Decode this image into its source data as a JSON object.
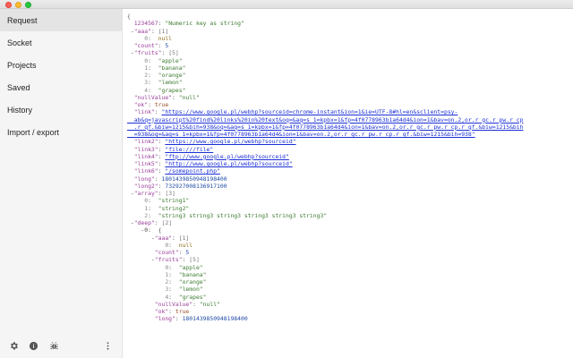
{
  "sidebar": {
    "items": [
      {
        "label": "Request",
        "active": true
      },
      {
        "label": "Socket",
        "active": false
      },
      {
        "label": "Projects",
        "active": false
      },
      {
        "label": "Saved",
        "active": false
      },
      {
        "label": "History",
        "active": false
      },
      {
        "label": "Import / export",
        "active": false
      }
    ],
    "footer_icons": [
      "gear-icon",
      "info-icon",
      "bug-icon",
      "more-vertical-icon"
    ]
  },
  "json_view": {
    "lines": [
      [
        {
          "t": "{",
          "c": "punc"
        }
      ],
      [
        {
          "t": "  1234567",
          "c": "key"
        },
        {
          "t": ": ",
          "c": "punc"
        },
        {
          "t": "\"Numeric key as string\"",
          "c": "str"
        }
      ],
      [
        {
          "t": " -",
          "c": "tog"
        },
        {
          "t": "\"aaa\"",
          "c": "key"
        },
        {
          "t": ": ",
          "c": "punc"
        },
        {
          "t": "[1]",
          "c": "cnt"
        }
      ],
      [
        {
          "t": "     0",
          "c": "idx"
        },
        {
          "t": ":  ",
          "c": "punc"
        },
        {
          "t": "null",
          "c": "nul"
        }
      ],
      [
        {
          "t": "  \"count\"",
          "c": "key"
        },
        {
          "t": ": ",
          "c": "punc"
        },
        {
          "t": "5",
          "c": "num"
        }
      ],
      [
        {
          "t": " -",
          "c": "tog"
        },
        {
          "t": "\"fruits\"",
          "c": "key"
        },
        {
          "t": ": ",
          "c": "punc"
        },
        {
          "t": "[5]",
          "c": "cnt"
        }
      ],
      [
        {
          "t": "     0",
          "c": "idx"
        },
        {
          "t": ":  ",
          "c": "punc"
        },
        {
          "t": "\"apple\"",
          "c": "str"
        }
      ],
      [
        {
          "t": "     1",
          "c": "idx"
        },
        {
          "t": ":  ",
          "c": "punc"
        },
        {
          "t": "\"banana\"",
          "c": "str"
        }
      ],
      [
        {
          "t": "     2",
          "c": "idx"
        },
        {
          "t": ":  ",
          "c": "punc"
        },
        {
          "t": "\"orange\"",
          "c": "str"
        }
      ],
      [
        {
          "t": "     3",
          "c": "idx"
        },
        {
          "t": ":  ",
          "c": "punc"
        },
        {
          "t": "\"lemon\"",
          "c": "str"
        }
      ],
      [
        {
          "t": "     4",
          "c": "idx"
        },
        {
          "t": ":  ",
          "c": "punc"
        },
        {
          "t": "\"grapes\"",
          "c": "str"
        }
      ],
      [
        {
          "t": "  \"nullValue\"",
          "c": "key"
        },
        {
          "t": ": ",
          "c": "punc"
        },
        {
          "t": "\"null\"",
          "c": "str"
        }
      ],
      [
        {
          "t": "  \"ok\"",
          "c": "key"
        },
        {
          "t": ": ",
          "c": "punc"
        },
        {
          "t": "true",
          "c": "bool"
        }
      ],
      [
        {
          "t": "  \"link\"",
          "c": "key"
        },
        {
          "t": ": ",
          "c": "punc"
        },
        {
          "t": "\"https://www.google.pl/webhp?sourceid=chrome-instant&ion=1&ie=UTF-8#hl=en&sclient=psy-",
          "c": "link"
        }
      ],
      [
        {
          "t": "  ab&q=javascript%20find%20links%20in%20text&oq=&aq=s_1=kpbx=1&fp=4f077896",
          "c": "link"
        },
        {
          "t": "3b1a64d4&ion=1&bav=on.2,or.r_gc.r_pw.r_cp",
          "c": "link"
        }
      ],
      [
        {
          "t": "  .r_qf.&biw=1215&bih=938&oq=&aq=s_1=kpbx=1&fp=4f077896",
          "c": "link"
        },
        {
          "t": "3b1a64d4&ion=1&bav=on.2,or.r_gc.r_pw.r_cp.r_qf.&biw=1215&bih",
          "c": "link"
        }
      ],
      [
        {
          "t": "  =938&oq=&aq=s_1=kpbx=1&fp=4f0778963b1a64d4&ion=1&bav=on.2,or.r_gc.r_pw.r_cp.r_qf.&biw=1215&bih=938\"",
          "c": "link"
        }
      ],
      [
        {
          "t": "  \"link2\"",
          "c": "key"
        },
        {
          "t": ": ",
          "c": "punc"
        },
        {
          "t": "\"https://www.google.pl/webhp?sourceid\"",
          "c": "link"
        }
      ],
      [
        {
          "t": "  \"link3\"",
          "c": "key"
        },
        {
          "t": ": ",
          "c": "punc"
        },
        {
          "t": "\"file:///file\"",
          "c": "link"
        }
      ],
      [
        {
          "t": "  \"link4\"",
          "c": "key"
        },
        {
          "t": ": ",
          "c": "punc"
        },
        {
          "t": "\"ftp://www.google.pl/webhp?sourceid\"",
          "c": "link"
        }
      ],
      [
        {
          "t": "  \"link5\"",
          "c": "key"
        },
        {
          "t": ": ",
          "c": "punc"
        },
        {
          "t": "\"http://www.google.pl/webhp?sourceid\"",
          "c": "link"
        }
      ],
      [
        {
          "t": "  \"link6\"",
          "c": "key"
        },
        {
          "t": ": ",
          "c": "punc"
        },
        {
          "t": "\"/somepoint.php\"",
          "c": "link"
        }
      ],
      [
        {
          "t": "  \"long\"",
          "c": "key"
        },
        {
          "t": ": ",
          "c": "punc"
        },
        {
          "t": "1801439850948198400",
          "c": "num"
        }
      ],
      [
        {
          "t": "  \"long2\"",
          "c": "key"
        },
        {
          "t": ": ",
          "c": "punc"
        },
        {
          "t": "732927008136917100",
          "c": "num"
        }
      ],
      [
        {
          "t": " -",
          "c": "tog"
        },
        {
          "t": "\"array\"",
          "c": "key"
        },
        {
          "t": ": ",
          "c": "punc"
        },
        {
          "t": "[3]",
          "c": "cnt"
        }
      ],
      [
        {
          "t": "     0",
          "c": "idx"
        },
        {
          "t": ":  ",
          "c": "punc"
        },
        {
          "t": "\"string1\"",
          "c": "str"
        }
      ],
      [
        {
          "t": "     1",
          "c": "idx"
        },
        {
          "t": ":  ",
          "c": "punc"
        },
        {
          "t": "\"string2\"",
          "c": "str"
        }
      ],
      [
        {
          "t": "     2",
          "c": "idx"
        },
        {
          "t": ":  ",
          "c": "punc"
        },
        {
          "t": "\"string3 string3 string3 string3 string3 string3\"",
          "c": "str"
        }
      ],
      [
        {
          "t": " -",
          "c": "tog"
        },
        {
          "t": "\"deep\"",
          "c": "key"
        },
        {
          "t": ": ",
          "c": "punc"
        },
        {
          "t": "[2]",
          "c": "cnt"
        }
      ],
      [
        {
          "t": "    -0",
          "c": "tog"
        },
        {
          "t": ":  {",
          "c": "punc"
        }
      ],
      [
        {
          "t": "       -",
          "c": "tog"
        },
        {
          "t": "\"aaa\"",
          "c": "key"
        },
        {
          "t": ": ",
          "c": "punc"
        },
        {
          "t": "[1]",
          "c": "cnt"
        }
      ],
      [
        {
          "t": "           0",
          "c": "idx"
        },
        {
          "t": ":  ",
          "c": "punc"
        },
        {
          "t": "null",
          "c": "nul"
        }
      ],
      [
        {
          "t": "        \"count\"",
          "c": "key"
        },
        {
          "t": ": ",
          "c": "punc"
        },
        {
          "t": "5",
          "c": "num"
        }
      ],
      [
        {
          "t": "       -",
          "c": "tog"
        },
        {
          "t": "\"fruits\"",
          "c": "key"
        },
        {
          "t": ": ",
          "c": "punc"
        },
        {
          "t": "[5]",
          "c": "cnt"
        }
      ],
      [
        {
          "t": "           0",
          "c": "idx"
        },
        {
          "t": ":  ",
          "c": "punc"
        },
        {
          "t": "\"apple\"",
          "c": "str"
        }
      ],
      [
        {
          "t": "           1",
          "c": "idx"
        },
        {
          "t": ":  ",
          "c": "punc"
        },
        {
          "t": "\"banana\"",
          "c": "str"
        }
      ],
      [
        {
          "t": "           2",
          "c": "idx"
        },
        {
          "t": ":  ",
          "c": "punc"
        },
        {
          "t": "\"orange\"",
          "c": "str"
        }
      ],
      [
        {
          "t": "           3",
          "c": "idx"
        },
        {
          "t": ":  ",
          "c": "punc"
        },
        {
          "t": "\"lemon\"",
          "c": "str"
        }
      ],
      [
        {
          "t": "           4",
          "c": "idx"
        },
        {
          "t": ":  ",
          "c": "punc"
        },
        {
          "t": "\"grapes\"",
          "c": "str"
        }
      ],
      [
        {
          "t": "        \"nullValue\"",
          "c": "key"
        },
        {
          "t": ": ",
          "c": "punc"
        },
        {
          "t": "\"null\"",
          "c": "str"
        }
      ],
      [
        {
          "t": "        \"ok\"",
          "c": "key"
        },
        {
          "t": ": ",
          "c": "punc"
        },
        {
          "t": "true",
          "c": "bool"
        }
      ],
      [
        {
          "t": "        \"long\"",
          "c": "key"
        },
        {
          "t": ": ",
          "c": "punc"
        },
        {
          "t": "1801439850948198400",
          "c": "num"
        }
      ]
    ]
  }
}
